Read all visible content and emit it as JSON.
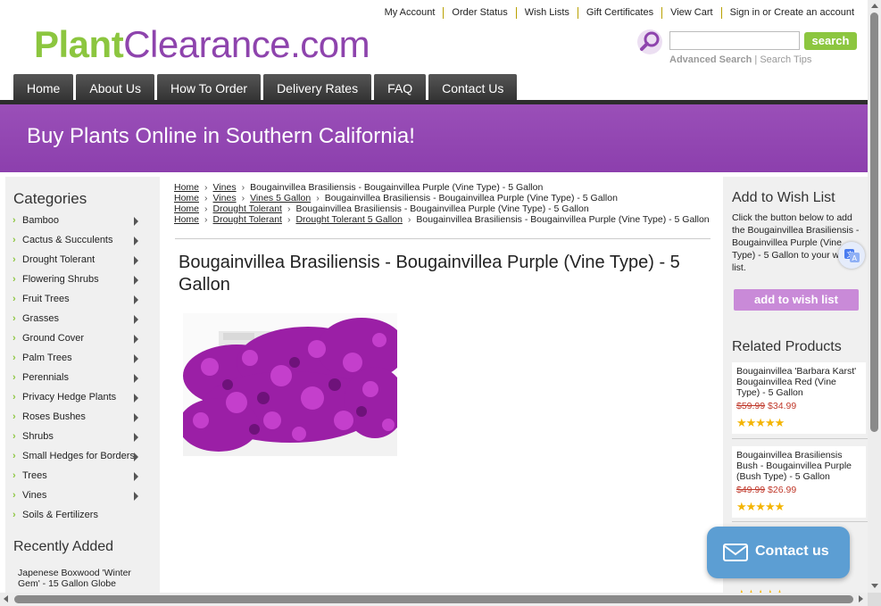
{
  "top_links": [
    "My Account",
    "Order Status",
    "Wish Lists",
    "Gift Certificates",
    "View Cart",
    "Sign in or Create an account"
  ],
  "logo": {
    "part1": "Plant",
    "part2": "Clearance.com"
  },
  "search": {
    "placeholder": "",
    "button_label": "search",
    "advanced_link": "Advanced Search",
    "separator": "|",
    "tips_link": "Search Tips"
  },
  "nav": [
    "Home",
    "About Us",
    "How To Order",
    "Delivery Rates",
    "FAQ",
    "Contact Us"
  ],
  "banner": {
    "title": "Buy Plants Online in Southern California!"
  },
  "categories": {
    "heading": "Categories",
    "items": [
      "Bamboo",
      "Cactus & Succulents",
      "Drought Tolerant",
      "Flowering Shrubs",
      "Fruit Trees",
      "Grasses",
      "Ground Cover",
      "Palm Trees",
      "Perennials",
      "Privacy Hedge Plants",
      "Roses Bushes",
      "Shrubs",
      "Small Hedges for Borders",
      "Trees",
      "Vines",
      "Soils & Fertilizers"
    ]
  },
  "recently_added": {
    "heading": "Recently Added",
    "item": "Japenese Boxwood 'Winter Gem' - 15 Gallon Globe"
  },
  "breadcrumbs": [
    {
      "links": [
        "Home",
        "Vines"
      ],
      "current": "Bougainvillea Brasiliensis - Bougainvillea Purple (Vine Type) - 5 Gallon"
    },
    {
      "links": [
        "Home",
        "Vines",
        "Vines 5 Gallon"
      ],
      "current": "Bougainvillea Brasiliensis - Bougainvillea Purple (Vine Type) - 5 Gallon"
    },
    {
      "links": [
        "Home",
        "Drought Tolerant"
      ],
      "current": "Bougainvillea Brasiliensis - Bougainvillea Purple (Vine Type) - 5 Gallon"
    },
    {
      "links": [
        "Home",
        "Drought Tolerant",
        "Drought Tolerant 5 Gallon"
      ],
      "current": "Bougainvillea Brasiliensis - Bougainvillea Purple (Vine Type) - 5 Gallon"
    }
  ],
  "product": {
    "title": "Bougainvillea Brasiliensis - Bougainvillea Purple (Vine Type) - 5 Gallon"
  },
  "wish_list": {
    "heading": "Add to Wish List",
    "text": "Click the button below to add the Bougainvillea Brasiliensis - Bougainvillea Purple (Vine Type) - 5 Gallon to your wish list.",
    "button_label": "add to wish list"
  },
  "related": {
    "heading": "Related Products",
    "items": [
      {
        "name": "Bougainvillea 'Barbara Karst' Bougainvillea Red (Vine Type) - 5 Gallon",
        "old_price": "$59.99",
        "new_price": "$34.99",
        "rating": 5
      },
      {
        "name": "Bougainvillea Brasiliensis Bush - Bougainvillea Purple (Bush Type) - 5 Gallon",
        "old_price": "$49.99",
        "new_price": "$26.99",
        "rating": 5
      }
    ],
    "extra_rating": 5
  },
  "contact_widget": {
    "label": "Contact us"
  },
  "colors": {
    "brand_green": "#8cc63f",
    "brand_purple": "#8e44ad",
    "banner": "#9a4fb8",
    "contact_blue": "#5c9ed3"
  }
}
